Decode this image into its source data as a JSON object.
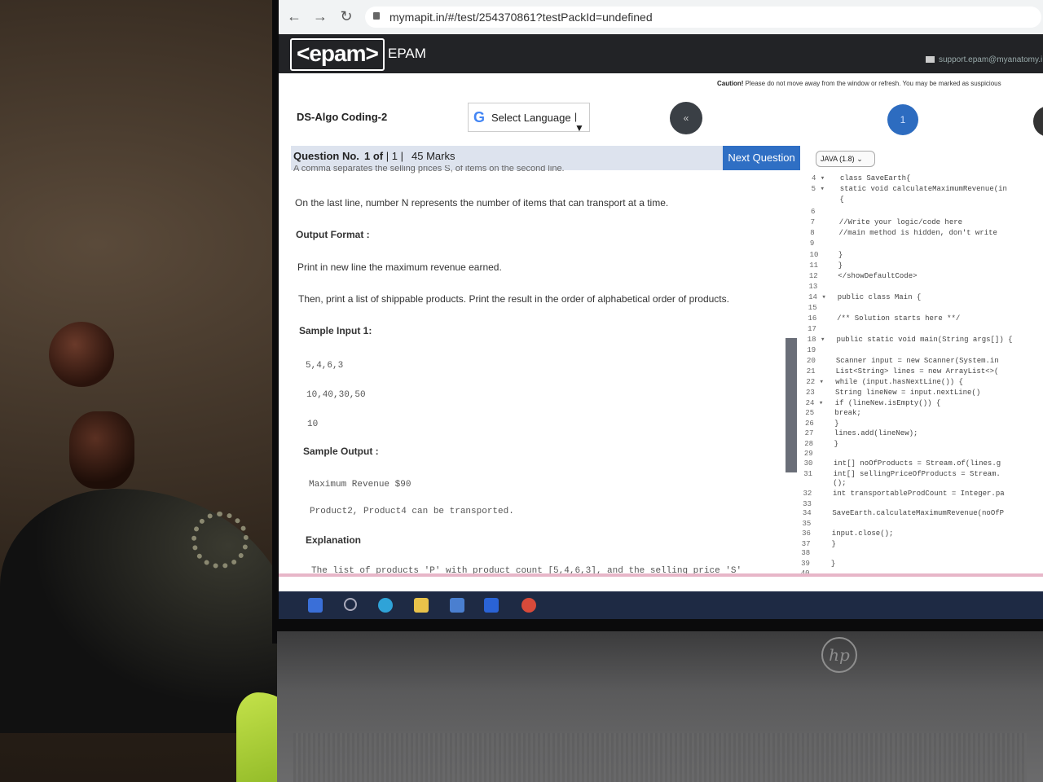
{
  "browser": {
    "url": "mymapit.in/#/test/254370861?testPackId=undefined"
  },
  "header": {
    "logo": "<epam>",
    "brand": "EPAM",
    "support_email": "support.epam@myanatomy.i"
  },
  "caution": {
    "label": "Caution!",
    "text": "Please do not move away from the window or refresh. You may be marked as suspicious"
  },
  "test": {
    "title": "DS-Algo Coding-2",
    "language_selector": "Select Language",
    "collapse_label": "«",
    "question_bubble": "1"
  },
  "question_bar": {
    "label": "Question No.",
    "number": "1 of",
    "total": "1",
    "marks": "45 Marks",
    "next_button": "Next Question"
  },
  "question": {
    "cutoff_line": "A comma separates the selling prices S, of items on the second line.",
    "last_line": "On the last line, number N represents the number of items that can transport at a time.",
    "output_format_heading": "Output Format :",
    "output_line1": "Print in new line the maximum revenue earned.",
    "output_line2": "Then, print a list of shippable products. Print the result in the order of alphabetical order of products.",
    "sample_input_heading": "Sample Input 1:",
    "sample_input": [
      "5,4,6,3",
      "10,40,30,50",
      "10"
    ],
    "sample_output_heading": "Sample Output :",
    "sample_output": [
      "Maximum Revenue $90",
      "Product2, Product4 can be transported."
    ],
    "explanation_heading": "Explanation",
    "explanation_text": "The list of products 'P' with product count [5,4,6,3], and the selling price 'S'"
  },
  "editor": {
    "language": "JAVA (1.8)",
    "lines": [
      {
        "n": "4 ▾",
        "code": "class SaveEarth{"
      },
      {
        "n": "5 ▾",
        "code": "    static void calculateMaximumRevenue(in"
      },
      {
        "n": "",
        "code": "        {"
      },
      {
        "n": "6",
        "code": ""
      },
      {
        "n": "7",
        "code": "        //Write your logic/code here"
      },
      {
        "n": "8",
        "code": "        //main method is hidden, don't write"
      },
      {
        "n": "9",
        "code": ""
      },
      {
        "n": "10",
        "code": "        }"
      },
      {
        "n": "11",
        "code": "}"
      },
      {
        "n": "12",
        "code": "</showDefaultCode>"
      },
      {
        "n": "13",
        "code": ""
      },
      {
        "n": "14 ▾",
        "code": "public class Main {"
      },
      {
        "n": "15",
        "code": ""
      },
      {
        "n": "16",
        "code": "    /** Solution starts here **/"
      },
      {
        "n": "17",
        "code": ""
      },
      {
        "n": "18 ▾",
        "code": "    public static void main(String args[]) {"
      },
      {
        "n": "19",
        "code": ""
      },
      {
        "n": "20",
        "code": "        Scanner input = new Scanner(System.in"
      },
      {
        "n": "21",
        "code": "        List<String> lines = new ArrayList<>("
      },
      {
        "n": "22 ▾",
        "code": "        while (input.hasNextLine()) {"
      },
      {
        "n": "23",
        "code": "            String lineNew = input.nextLine()"
      },
      {
        "n": "24 ▾",
        "code": "            if (lineNew.isEmpty()) {"
      },
      {
        "n": "25",
        "code": "                break;"
      },
      {
        "n": "26",
        "code": "            }"
      },
      {
        "n": "27",
        "code": "            lines.add(lineNew);"
      },
      {
        "n": "28",
        "code": "        }"
      },
      {
        "n": "29",
        "code": ""
      },
      {
        "n": "30",
        "code": "        int[] noOfProducts = Stream.of(lines.g"
      },
      {
        "n": "31",
        "code": "        int[] sellingPriceOfProducts = Stream."
      },
      {
        "n": "",
        "code": "            ();"
      },
      {
        "n": "32",
        "code": "        int transportableProdCount = Integer.pa"
      },
      {
        "n": "33",
        "code": ""
      },
      {
        "n": "34",
        "code": "        SaveEarth.calculateMaximumRevenue(noOfP"
      },
      {
        "n": "35",
        "code": ""
      },
      {
        "n": "36",
        "code": "        input.close();"
      },
      {
        "n": "37",
        "code": "    }"
      },
      {
        "n": "38",
        "code": ""
      },
      {
        "n": "39",
        "code": "}"
      },
      {
        "n": "40",
        "code": ""
      }
    ]
  },
  "device": {
    "brand": "hp"
  },
  "icons": [
    "back-arrow-icon",
    "forward-arrow-icon",
    "reload-icon",
    "lock-icon",
    "mail-icon",
    "google-icon",
    "windows-start-icon",
    "search-icon",
    "edge-icon",
    "file-explorer-icon",
    "mail-app-icon",
    "dropbox-icon",
    "chrome-icon"
  ]
}
